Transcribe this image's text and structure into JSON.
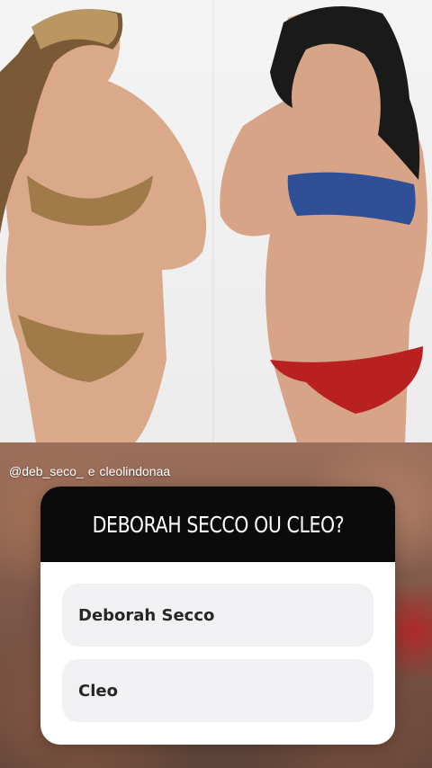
{
  "story": {
    "mentions": {
      "first": "@deb_seco_",
      "separator": "e",
      "second": "cleolindonaa"
    },
    "poll": {
      "question": "DEBORAH SECCO OU CLEO?",
      "options": [
        {
          "label": "Deborah Secco"
        },
        {
          "label": "Cleo"
        }
      ]
    }
  },
  "colors": {
    "poll_header_bg": "#0b0b0b",
    "poll_option_bg": "#f1f1f3",
    "poll_card_bg": "#ffffff"
  }
}
